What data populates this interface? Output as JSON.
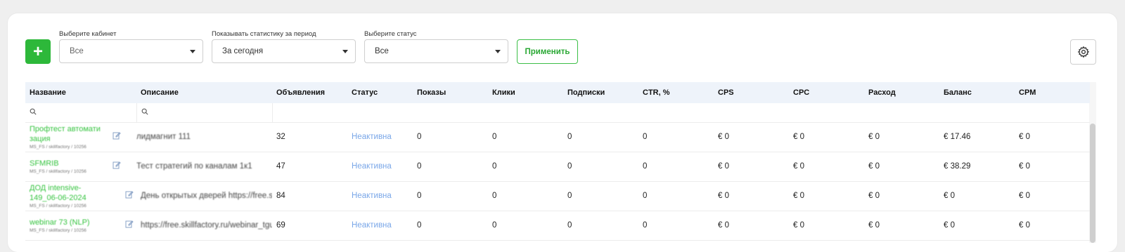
{
  "filters": {
    "cabinet_label": "Выберите кабинет",
    "cabinet_value": "Все",
    "period_label": "Показывать статистику за период",
    "period_value": "За сегодня",
    "status_label": "Выберите статус",
    "status_value": "Все",
    "apply_label": "Применить",
    "add_label": "+"
  },
  "table": {
    "headers": [
      "Название",
      "Описание",
      "Объявления",
      "Статус",
      "Показы",
      "Клики",
      "Подписки",
      "CTR, %",
      "CPS",
      "CPC",
      "Расход",
      "Баланс",
      "CPM"
    ],
    "rows": [
      {
        "name": "Профтест автомати зация",
        "sub": "MS_FS / skillfactory / 10256",
        "desc": "лидмагнит 111",
        "ads": "32",
        "status": "Неактивна",
        "shows": "0",
        "clicks": "0",
        "subs": "0",
        "ctr": "0",
        "cps": "€ 0",
        "cpc": "€ 0",
        "spend": "€ 0",
        "balance": "€ 17.46",
        "cpm": "€ 0"
      },
      {
        "name": "SFMRIB",
        "sub": "MS_FS / skillfactory / 10256",
        "desc": "Тест стратегий по каналам 1к1",
        "ads": "47",
        "status": "Неактивна",
        "shows": "0",
        "clicks": "0",
        "subs": "0",
        "ctr": "0",
        "cps": "€ 0",
        "cpc": "€ 0",
        "spend": "€ 0",
        "balance": "€ 38.29",
        "cpm": "€ 0"
      },
      {
        "name": "ДОД intensive-149_06-06-2024",
        "sub": "MS_FS / skillfactory / 10256",
        "desc": "День открытых дверей https://free.skillfactory.ru",
        "ads": "84",
        "status": "Неактивна",
        "shows": "0",
        "clicks": "0",
        "subs": "0",
        "ctr": "0",
        "cps": "€ 0",
        "cpc": "€ 0",
        "spend": "€ 0",
        "balance": "€ 0",
        "cpm": "€ 0"
      },
      {
        "name": "webinar 73 (NLP)",
        "sub": "MS_FS / skillfactory / 10256",
        "desc": "https://free.skillfactory.ru/webinar_tgua",
        "ads": "69",
        "status": "Неактивна",
        "shows": "0",
        "clicks": "0",
        "subs": "0",
        "ctr": "0",
        "cps": "€ 0",
        "cpc": "€ 0",
        "spend": "€ 0",
        "balance": "€ 0",
        "cpm": "€ 0"
      }
    ]
  },
  "colors": {
    "accent": "#2db83a",
    "status_inactive": "#7aa7e8",
    "header_bg": "#eef3fa"
  },
  "icons": {
    "settings": "gear-icon",
    "edit": "edit-icon",
    "autopilot": "bolt-icon",
    "search": "search-icon"
  }
}
